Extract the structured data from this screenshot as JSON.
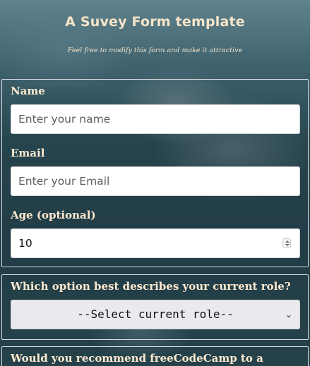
{
  "header": {
    "title": "A Suvey Form template",
    "subtitle": "Feel free to modify this form and make it attractive"
  },
  "form": {
    "name": {
      "label": "Name",
      "placeholder": "Enter your name"
    },
    "email": {
      "label": "Email",
      "placeholder": "Enter your Email"
    },
    "age": {
      "label": "Age (optional)",
      "value": "10"
    },
    "role": {
      "label": "Which option best describes your current role?",
      "selected": "--Select current role--"
    },
    "recommend": {
      "label": "Would you recommend freeCodeCamp to a"
    }
  },
  "colors": {
    "label_text": "#ffe9cf",
    "title_text": "#f7e4c8",
    "border": "#d8dfe2"
  }
}
